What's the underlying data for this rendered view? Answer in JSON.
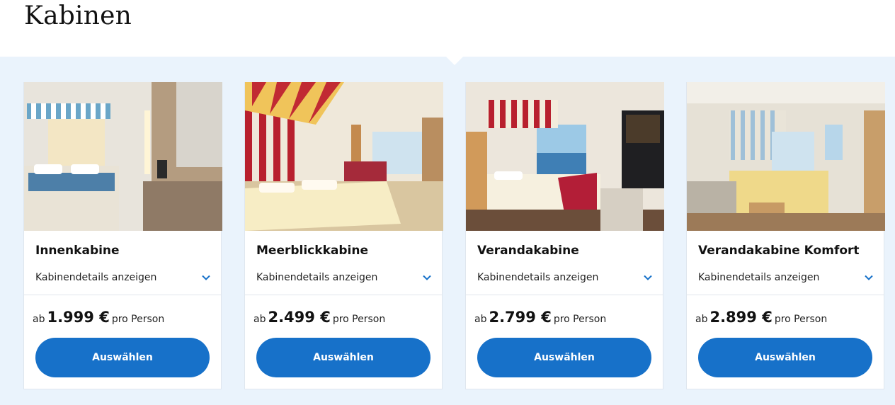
{
  "page": {
    "heading": "Kabinen"
  },
  "colors": {
    "accent": "#1771c9",
    "band": "#eaf3fc"
  },
  "cabins": [
    {
      "name": "Innenkabine",
      "details_label": "Kabinendetails anzeigen",
      "price_prefix": "ab",
      "price": "1.999 €",
      "price_suffix": "pro Person",
      "button_label": "Auswählen",
      "image_icon": "cabin-photo"
    },
    {
      "name": "Meerblickkabine",
      "details_label": "Kabinendetails anzeigen",
      "price_prefix": "ab",
      "price": "2.499 €",
      "price_suffix": "pro Person",
      "button_label": "Auswählen",
      "image_icon": "cabin-photo"
    },
    {
      "name": "Verandakabine",
      "details_label": "Kabinendetails anzeigen",
      "price_prefix": "ab",
      "price": "2.799 €",
      "price_suffix": "pro Person",
      "button_label": "Auswählen",
      "image_icon": "cabin-photo"
    },
    {
      "name": "Verandakabine Komfort",
      "details_label": "Kabinendetails anzeigen",
      "price_prefix": "ab",
      "price": "2.899 €",
      "price_suffix": "pro Person",
      "button_label": "Auswählen",
      "image_icon": "cabin-photo"
    }
  ]
}
